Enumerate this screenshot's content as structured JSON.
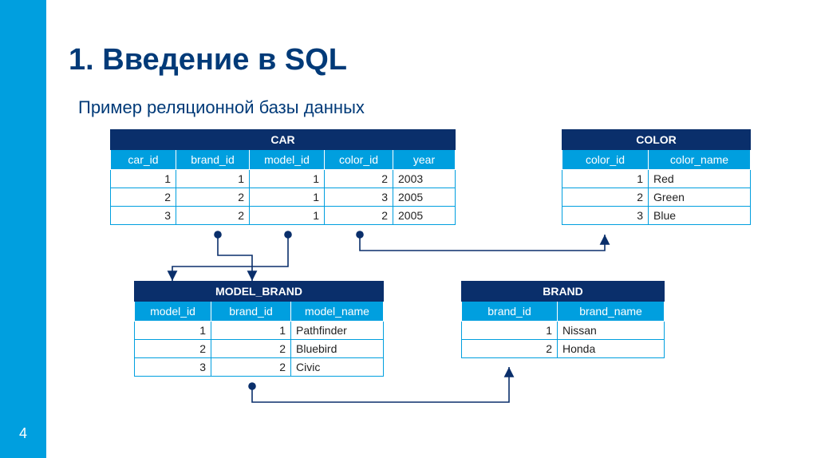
{
  "page_number": "4",
  "title": "1. Введение в SQL",
  "subtitle": "Пример реляционной базы данных",
  "colors": {
    "sidebar": "#009fdf",
    "header_dark": "#0a2f6b",
    "header_light": "#009fdf",
    "text_dark": "#003a78"
  },
  "tables": {
    "car": {
      "name": "CAR",
      "columns": [
        "car_id",
        "brand_id",
        "model_id",
        "color_id",
        "year"
      ],
      "col_types": [
        "num",
        "num",
        "num",
        "num",
        "txt"
      ],
      "rows": [
        [
          "1",
          "1",
          "1",
          "2",
          "2003"
        ],
        [
          "2",
          "2",
          "1",
          "3",
          "2005"
        ],
        [
          "3",
          "2",
          "1",
          "2",
          "2005"
        ]
      ]
    },
    "color": {
      "name": "COLOR",
      "columns": [
        "color_id",
        "color_name"
      ],
      "col_types": [
        "num",
        "txt"
      ],
      "rows": [
        [
          "1",
          "Red"
        ],
        [
          "2",
          "Green"
        ],
        [
          "3",
          "Blue"
        ]
      ]
    },
    "model_brand": {
      "name": "MODEL_BRAND",
      "columns": [
        "model_id",
        "brand_id",
        "model_name"
      ],
      "col_types": [
        "num",
        "num",
        "txt"
      ],
      "rows": [
        [
          "1",
          "1",
          "Pathfinder"
        ],
        [
          "2",
          "2",
          "Bluebird"
        ],
        [
          "3",
          "2",
          "Civic"
        ]
      ]
    },
    "brand": {
      "name": "BRAND",
      "columns": [
        "brand_id",
        "brand_name"
      ],
      "col_types": [
        "num",
        "txt"
      ],
      "rows": [
        [
          "1",
          "Nissan"
        ],
        [
          "2",
          "Honda"
        ]
      ]
    }
  },
  "relations": [
    {
      "from": "car.brand_id",
      "to": "model_brand.brand_id"
    },
    {
      "from": "car.model_id",
      "to": "model_brand.model_id"
    },
    {
      "from": "car.color_id",
      "to": "color.color_id"
    },
    {
      "from": "model_brand.brand_id",
      "to": "brand.brand_id"
    }
  ]
}
